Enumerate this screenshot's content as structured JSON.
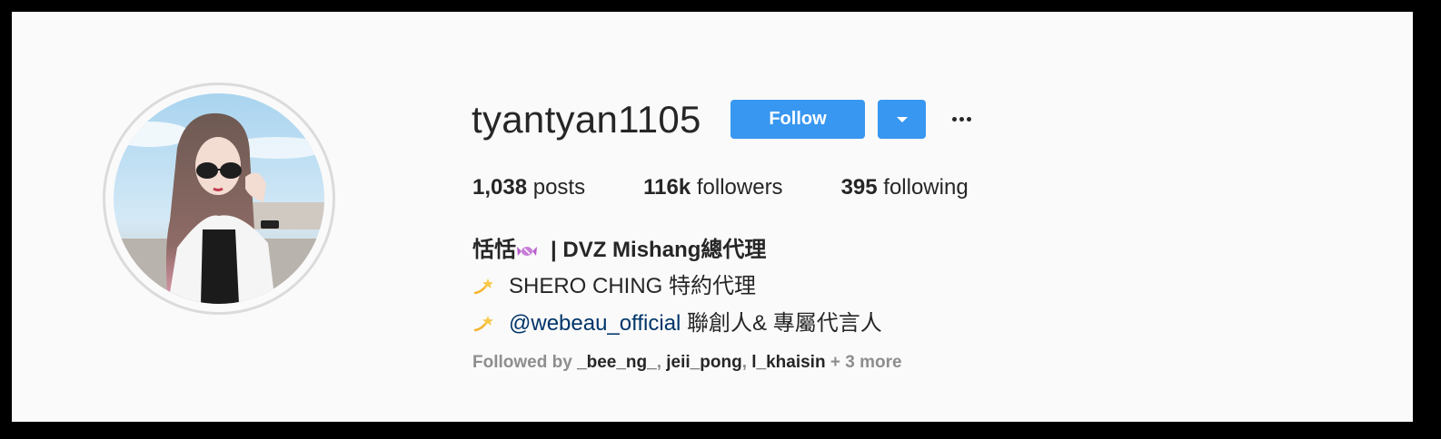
{
  "profile": {
    "username": "tyantyan1105",
    "follow_label": "Follow",
    "dropdown_icon": "chevron-down-icon",
    "more_icon": "more-options-icon"
  },
  "stats": [
    {
      "count": "1,038",
      "label": "posts"
    },
    {
      "count": "116k",
      "label": "followers"
    },
    {
      "count": "395",
      "label": "following"
    }
  ],
  "bio": {
    "name_part1": "恬恬",
    "name_part2": "| DVZ Mishang總代理",
    "line2": "SHERO CHING 特約代理",
    "line3_link": "@webeau_official",
    "line3_text": " 聯創人& 專屬代言人"
  },
  "followed_by": {
    "prefix": "Followed by ",
    "users": [
      "_bee_ng_",
      "jeii_pong",
      "l_khaisin"
    ],
    "sep1": ", ",
    "sep2": ", ",
    "more": " + 3 more"
  },
  "colors": {
    "accent": "#3897f0",
    "link": "#003569",
    "text": "#262626",
    "muted": "#8e8e8e"
  }
}
